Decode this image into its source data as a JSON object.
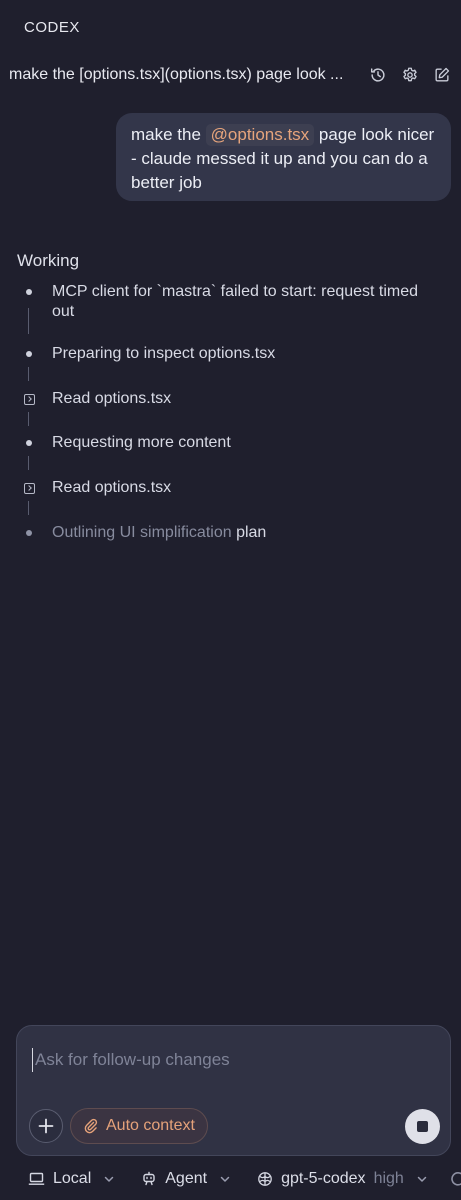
{
  "app": {
    "title": "CODEX"
  },
  "header": {
    "thread_title": "make the [options.tsx](options.tsx) page look ...",
    "icons": [
      "history-icon",
      "gear-icon",
      "edit-icon"
    ]
  },
  "user_message": {
    "before": "make the ",
    "mention": "@options.tsx",
    "after": " page look nicer - claude messed it up and you can do a better job"
  },
  "working": {
    "label": "Working",
    "steps": [
      {
        "icon": "dot",
        "text": "MCP client for `mastra` failed to start: request timed out"
      },
      {
        "icon": "dot",
        "text": "Preparing to inspect options.tsx"
      },
      {
        "icon": "terminal-icon",
        "text": "Read options.tsx"
      },
      {
        "icon": "dot",
        "text": "Requesting more content"
      },
      {
        "icon": "terminal-icon",
        "text": "Read options.tsx"
      },
      {
        "icon": "dot",
        "text_muted": "Outlining UI simplification",
        "text_rest": " plan"
      }
    ]
  },
  "composer": {
    "placeholder": "Ask for follow-up changes",
    "value": "",
    "context_label": "Auto context"
  },
  "footer": {
    "environment": "Local",
    "mode": "Agent",
    "model": "gpt-5-codex",
    "reasoning": "high"
  },
  "colors": {
    "background": "#1f1f2d",
    "bubble": "#33364a",
    "accent": "#e5a27a"
  }
}
